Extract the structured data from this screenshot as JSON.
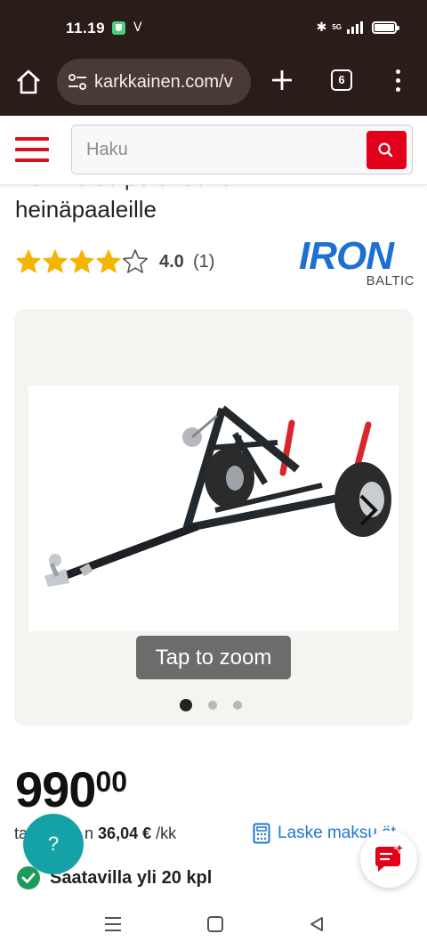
{
  "status_bar": {
    "time": "11.19",
    "network": "5G"
  },
  "browser": {
    "url": "karkkainen.com/v",
    "tab_count": "6"
  },
  "site": {
    "search": {
      "placeholder": "Haku"
    }
  },
  "product": {
    "title_partial": "Iron Baltic perävaunu",
    "title_line2": "heinäpaaleille",
    "rating": {
      "value": "4.0",
      "count": "(1)",
      "stars_filled": 4,
      "stars_total": 5
    },
    "brand": {
      "name": "IRON",
      "sub": "BALTIC"
    },
    "gallery": {
      "zoom_label": "Tap to zoom",
      "slide_count": 3,
      "active_slide": 1
    },
    "price": {
      "integer": "990",
      "decimals": "00"
    },
    "installment": {
      "prefix": "ta",
      "mid": "n",
      "amount": "36,04 €",
      "suffix": "/kk"
    },
    "calculator_link": "Laske maksu    ät",
    "availability": "Saatavilla yli 20 kpl"
  },
  "help_button": "?",
  "colors": {
    "brand_red": "#e3001b",
    "link_blue": "#1f78d1",
    "teal": "#15a2a6",
    "logo_blue": "#1f6fd3"
  }
}
